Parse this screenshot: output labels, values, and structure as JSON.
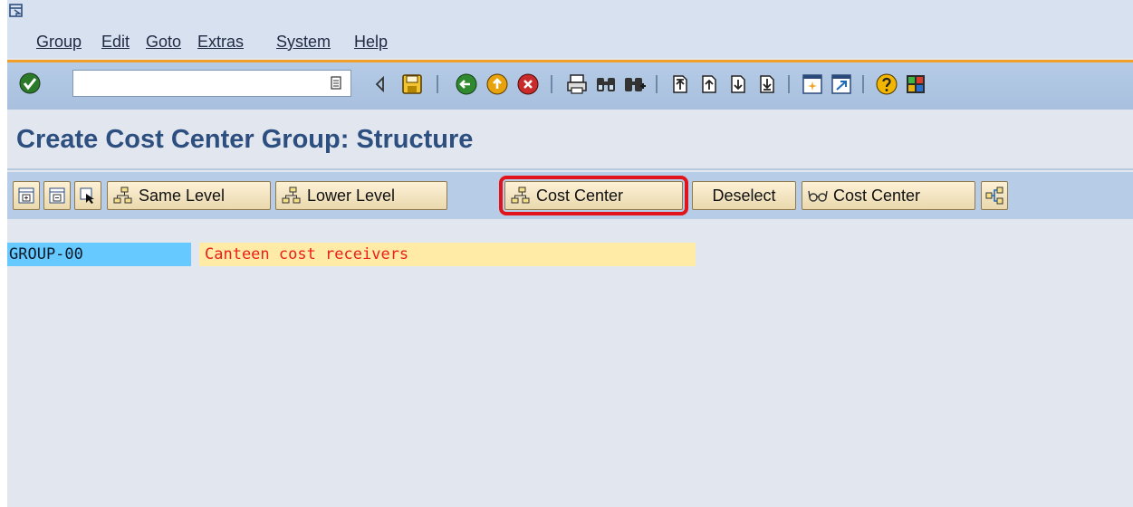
{
  "menubar": {
    "items": [
      {
        "label": "Group"
      },
      {
        "label": "Edit"
      },
      {
        "label": "Goto"
      },
      {
        "label": "Extras"
      },
      {
        "label": "System"
      },
      {
        "label": "Help"
      }
    ]
  },
  "std_toolbar": {
    "command_field": {
      "value": "",
      "placeholder": ""
    },
    "icons": [
      "enter-icon",
      "command-field-history-icon",
      "back-triangle-icon",
      "save-icon",
      "back-icon",
      "exit-icon",
      "cancel-icon",
      "print-icon",
      "find-icon",
      "find-next-icon",
      "first-page-icon",
      "previous-page-icon",
      "next-page-icon",
      "last-page-icon",
      "create-session-icon",
      "shortcut-icon",
      "help-icon",
      "customize-layout-icon"
    ]
  },
  "title": "Create Cost Center Group: Structure",
  "app_toolbar": {
    "buttons": [
      {
        "label": "",
        "icon": "expand-subtree-icon"
      },
      {
        "label": "",
        "icon": "collapse-subtree-icon"
      },
      {
        "label": "",
        "icon": "select-icon"
      },
      {
        "label": "Same Level",
        "icon": "hierarchy-icon"
      },
      {
        "label": "Lower Level",
        "icon": "hierarchy-icon"
      },
      {
        "label": "Cost Center",
        "icon": "hierarchy-icon"
      },
      {
        "label": "Deselect",
        "icon": ""
      },
      {
        "label": "Cost Center",
        "icon": "glasses-icon"
      },
      {
        "label": "",
        "icon": "move-icon"
      }
    ]
  },
  "tree": {
    "group_id": "GROUP-00",
    "group_description": "Canteen cost receivers"
  },
  "colors": {
    "title": "#2d4f80",
    "highlight": "#e1141b",
    "node_bg": "#66c9ff",
    "desc_bg": "#ffeba6",
    "desc_text": "#e8201e"
  }
}
